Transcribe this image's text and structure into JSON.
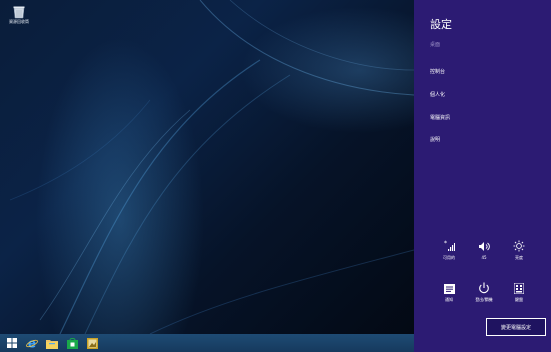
{
  "desktop": {
    "recycle_bin_label": "資源回收筒"
  },
  "taskbar": {
    "apps": [
      "start",
      "internet-explorer",
      "file-explorer",
      "store",
      "media-app"
    ]
  },
  "charm": {
    "title": "設定",
    "subtitle": "桌面",
    "links": [
      "控制台",
      "個人化",
      "電腦資訊",
      "說明"
    ],
    "quick_tiles": [
      {
        "label": "可用的",
        "icon": "network-icon"
      },
      {
        "label": "45",
        "icon": "volume-icon"
      },
      {
        "label": "亮度",
        "icon": "brightness-icon"
      },
      {
        "label": "通知",
        "icon": "notifications-icon"
      },
      {
        "label": "登出/關機",
        "icon": "power-icon"
      },
      {
        "label": "鍵盤",
        "icon": "keyboard-icon"
      }
    ],
    "change_pc_settings": "變更電腦設定"
  },
  "colors": {
    "charm_background": "#2c1b73",
    "taskbar": "#1e4b74",
    "desktop": "#0b2347"
  }
}
